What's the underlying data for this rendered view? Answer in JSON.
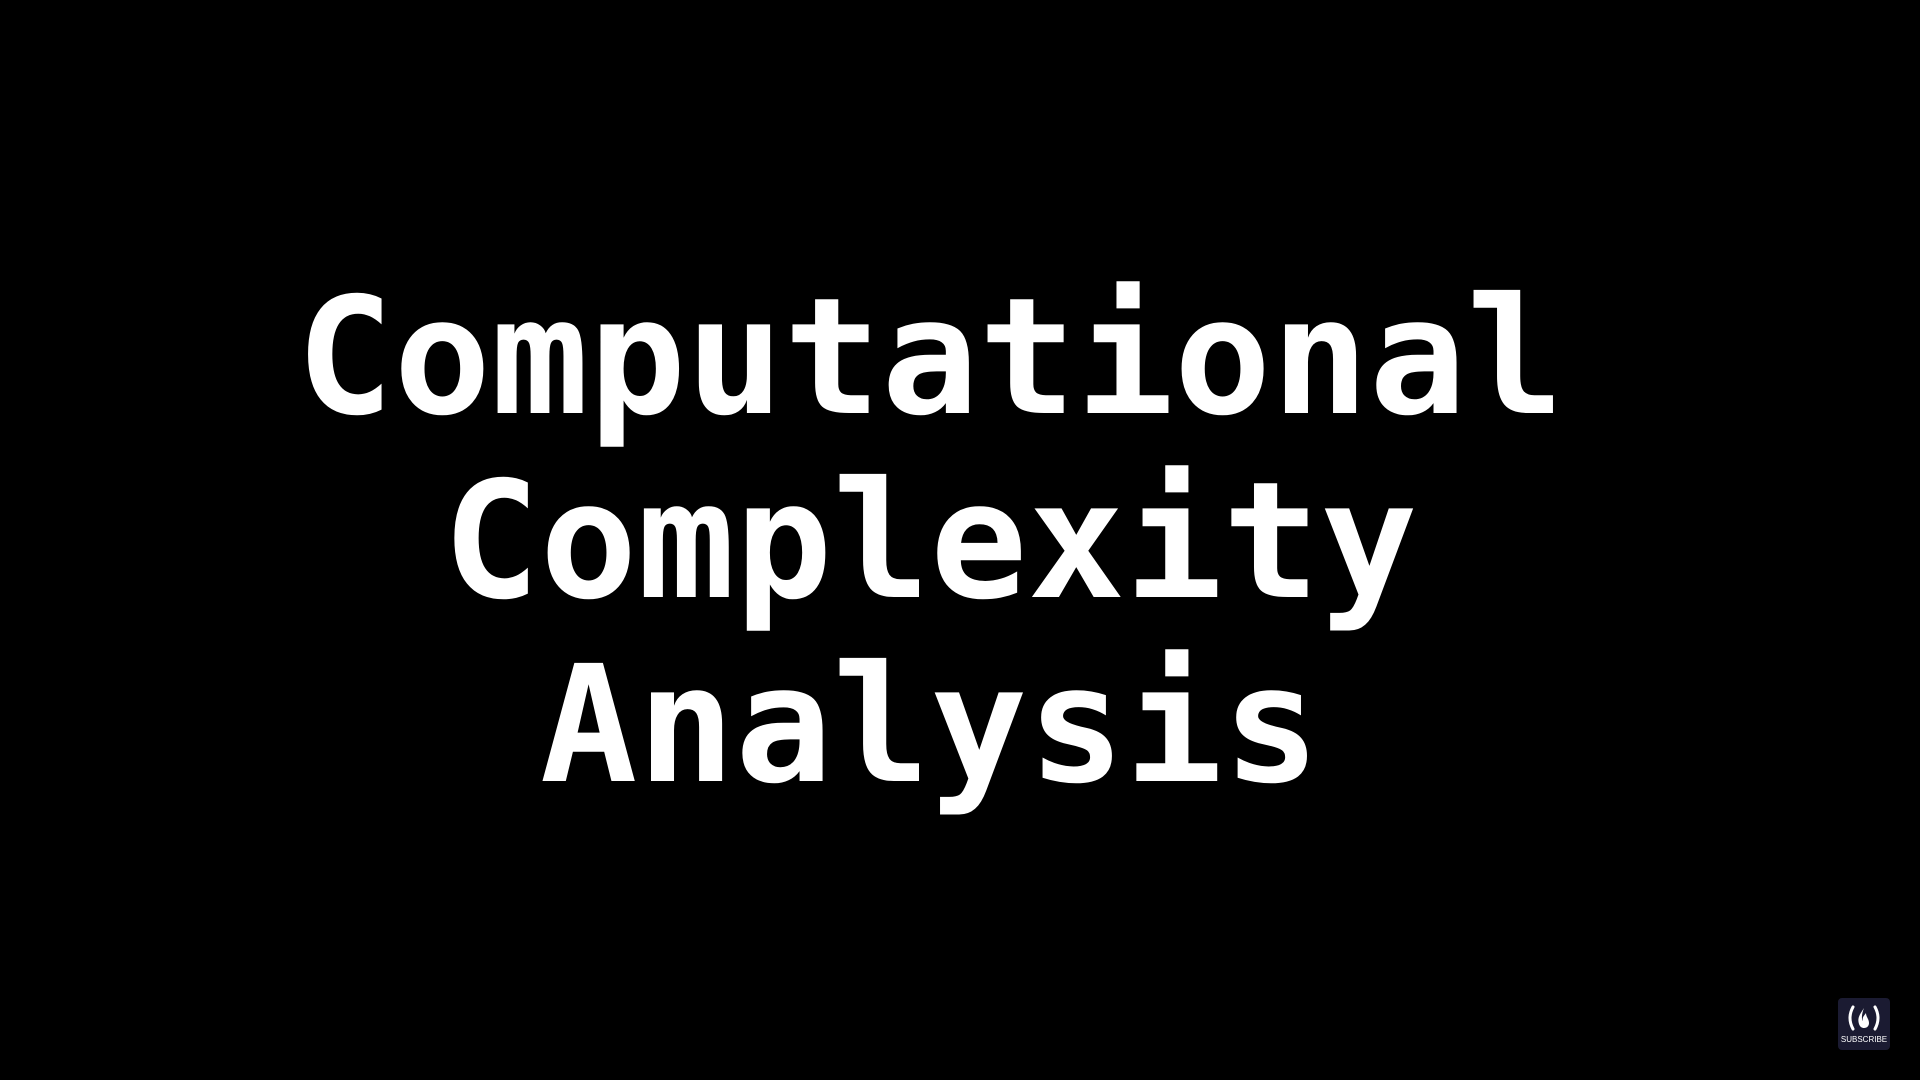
{
  "slide": {
    "title_lines": [
      "Computational",
      "Complexity",
      "Analysis"
    ],
    "text_color": "#ffffff",
    "background_color": "#000000"
  },
  "subscribe": {
    "label": "SUBSCRIBE",
    "icon": "freecodecamp-flame-icon",
    "background_color": "#1b1b32"
  }
}
